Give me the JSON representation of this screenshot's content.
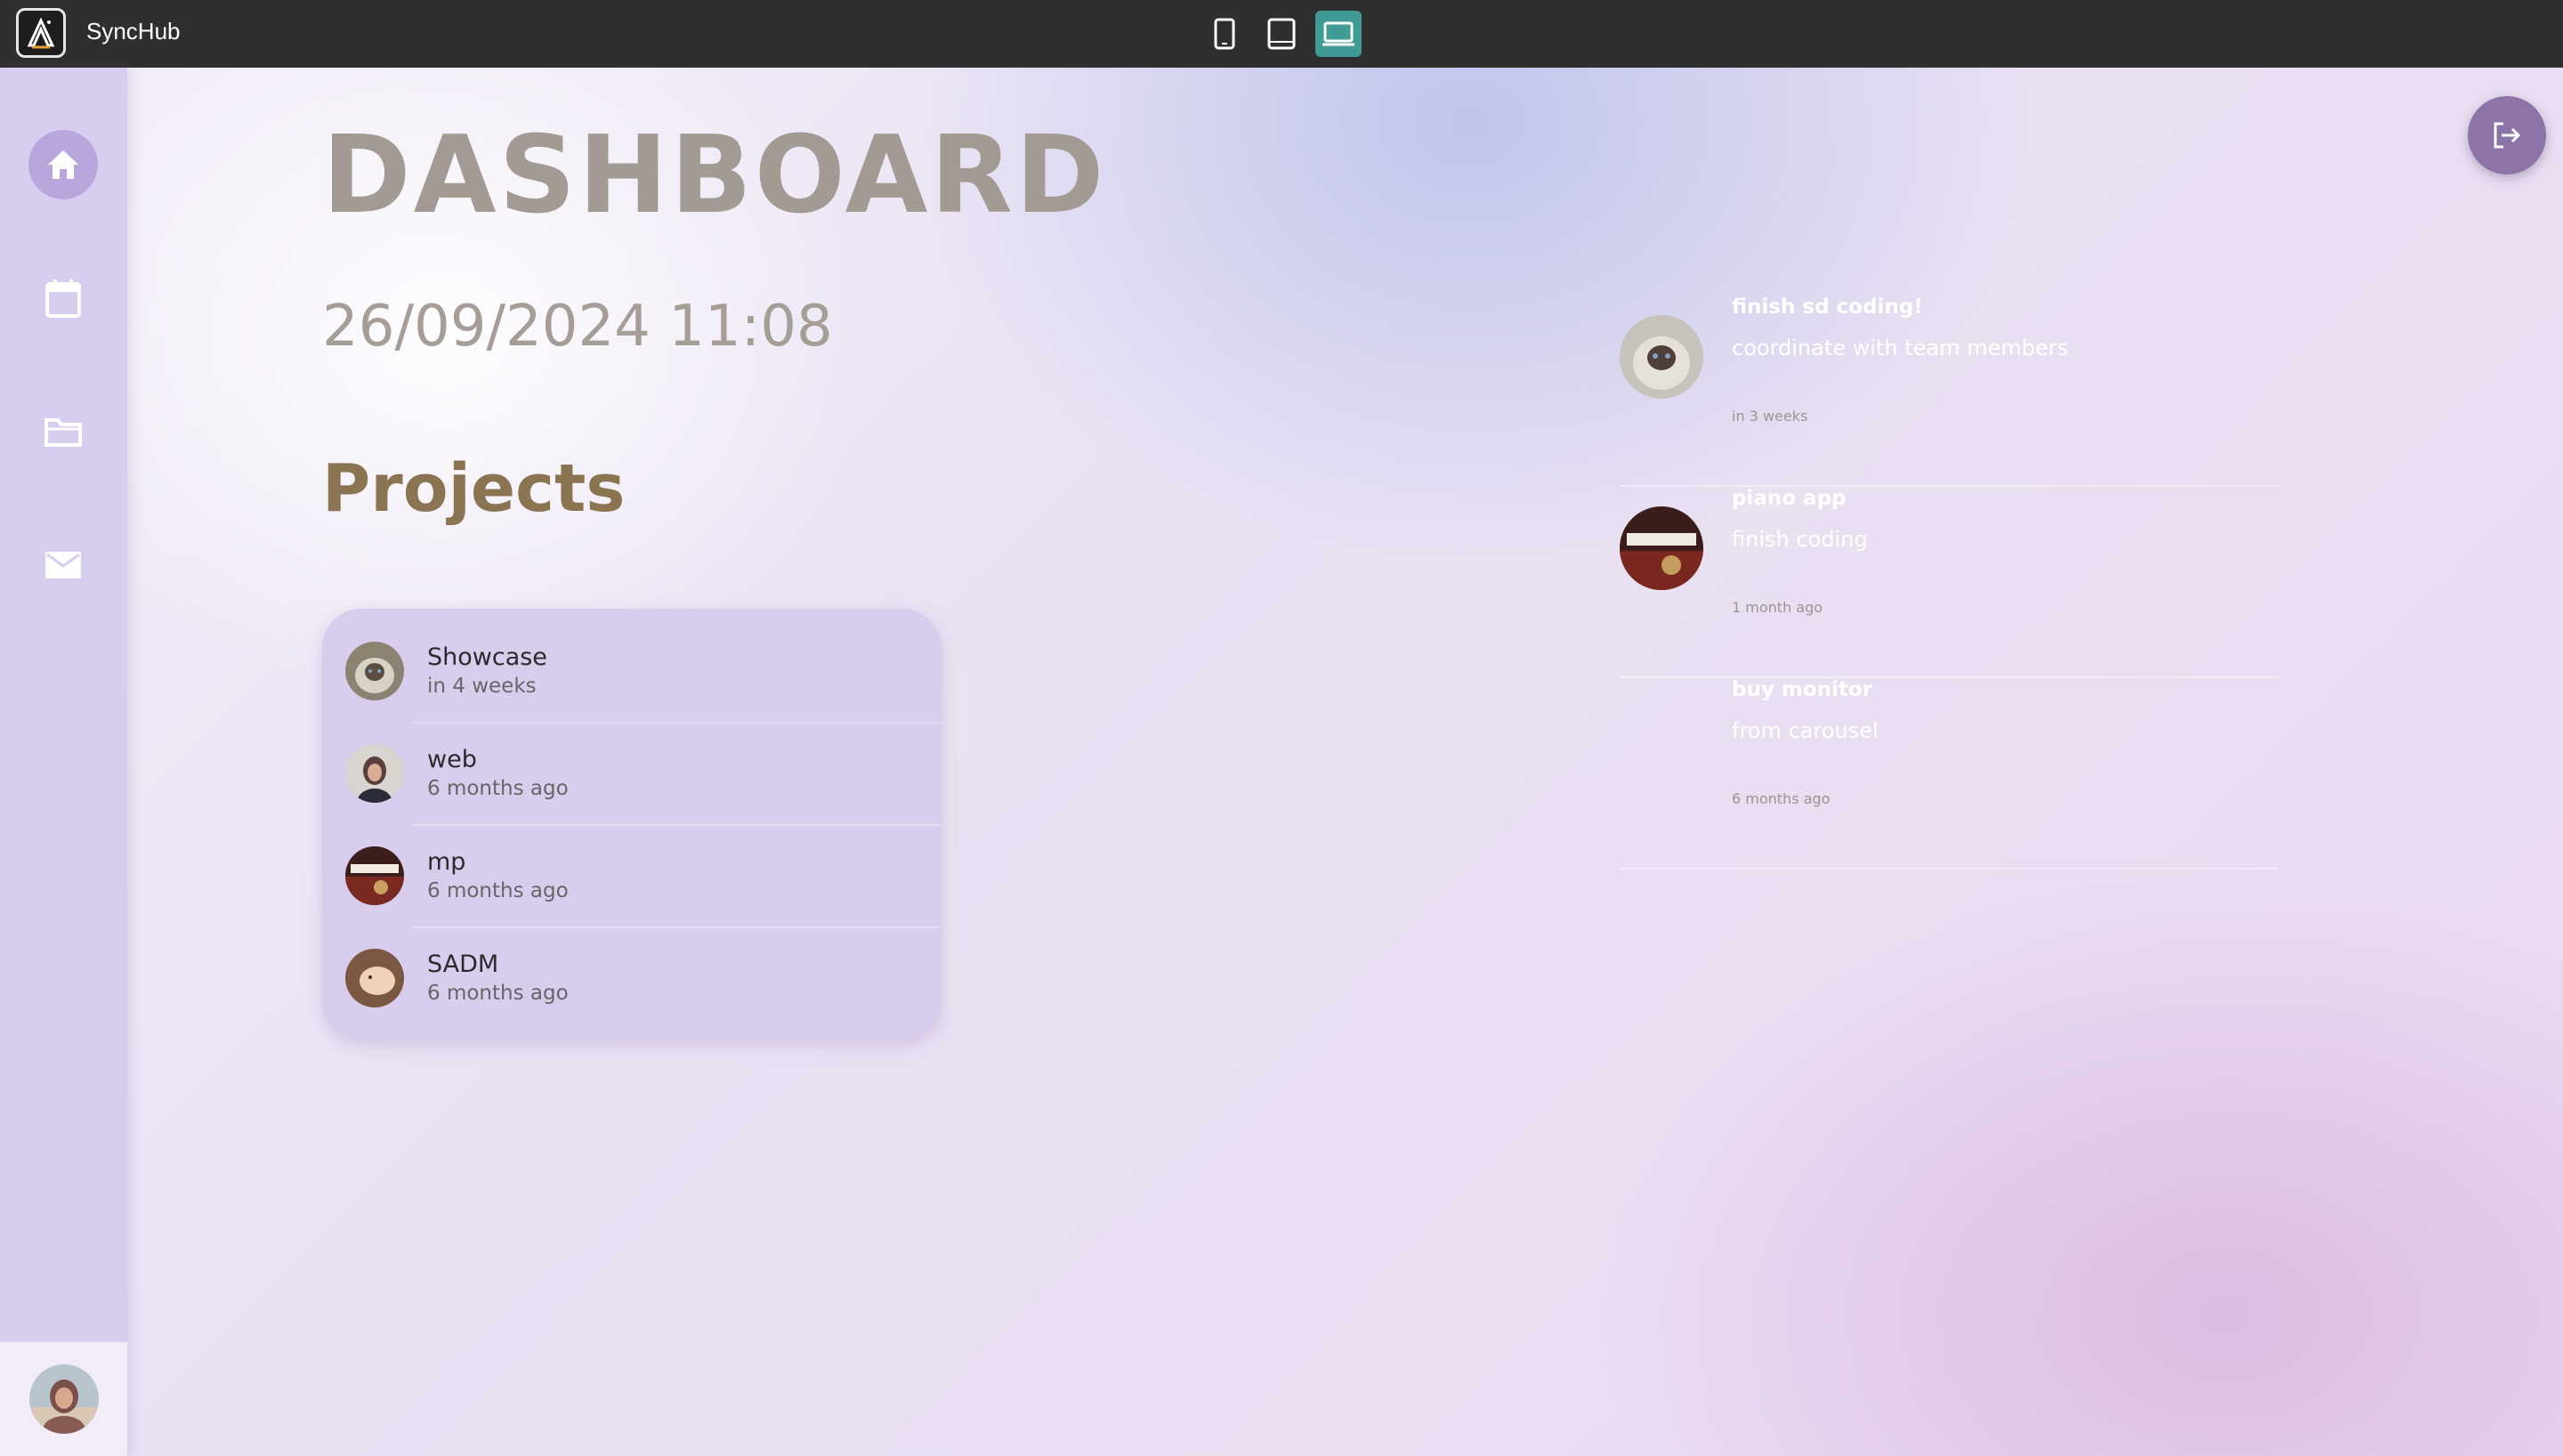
{
  "app": {
    "title": "SyncHub"
  },
  "device_switcher": [
    {
      "name": "mobile",
      "icon": "phone-icon",
      "active": false
    },
    {
      "name": "tablet",
      "icon": "tablet-icon",
      "active": false
    },
    {
      "name": "desktop",
      "icon": "laptop-icon",
      "active": true
    }
  ],
  "sidebar": {
    "items": [
      {
        "name": "home",
        "icon": "home-icon",
        "active": true
      },
      {
        "name": "calendar",
        "icon": "calendar-icon",
        "active": false
      },
      {
        "name": "projects",
        "icon": "folder-icon",
        "active": false
      },
      {
        "name": "messages",
        "icon": "mail-icon",
        "active": false
      }
    ]
  },
  "page": {
    "title": "DASHBOARD",
    "datetime": "26/09/2024 11:08",
    "projects_heading": "Projects"
  },
  "projects": [
    {
      "name": "Showcase",
      "time": "in 4 weeks"
    },
    {
      "name": "web",
      "time": "6 months ago"
    },
    {
      "name": "mp",
      "time": "6 months ago"
    },
    {
      "name": "SADM",
      "time": "6 months ago"
    }
  ],
  "activities": [
    {
      "title": "finish sd coding!",
      "description": "coordinate with team members",
      "time": "in 3 weeks"
    },
    {
      "title": "piano app",
      "description": "finish coding",
      "time": "1 month ago"
    },
    {
      "title": "buy monitor",
      "description": "from carousel",
      "time": "6 months ago"
    }
  ],
  "colors": {
    "topbar": "#2f2f2f",
    "accent_teal": "#3f9b93",
    "sidebar": "#d7cdee",
    "logout": "#8c74a9",
    "projects_heading": "#8a7452"
  }
}
